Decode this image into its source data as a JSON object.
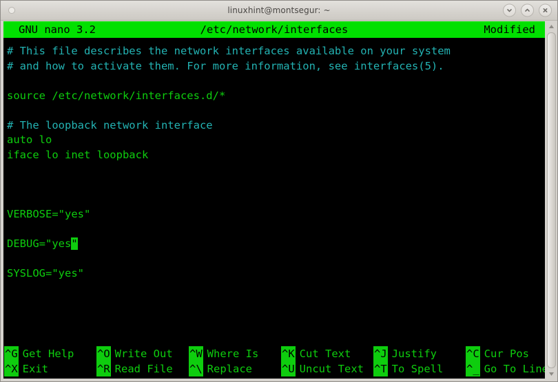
{
  "window": {
    "title": "linuxhint@montsegur: ~",
    "buttons": [
      {
        "name": "minimize",
        "glyph": "chevron-down"
      },
      {
        "name": "maximize",
        "glyph": "chevron-up"
      },
      {
        "name": "close",
        "glyph": "x"
      }
    ]
  },
  "nano": {
    "header": {
      "version": "GNU nano 3.2",
      "filename": "/etc/network/interfaces",
      "status": "Modified"
    },
    "colors": {
      "background": "#000000",
      "header_bg": "#00e000",
      "header_fg": "#000000",
      "code_fg": "#0ecd0e",
      "comment_fg": "#23b3b3",
      "cursor_bg": "#0ecd0e",
      "cursor_fg": "#000000"
    },
    "buffer": [
      {
        "text": "# This file describes the network interfaces available on your system",
        "type": "comment"
      },
      {
        "text": "# and how to activate them. For more information, see interfaces(5).",
        "type": "comment"
      },
      {
        "text": "",
        "type": "blank"
      },
      {
        "text": "source /etc/network/interfaces.d/*",
        "type": "code"
      },
      {
        "text": "",
        "type": "blank"
      },
      {
        "text": "# The loopback network interface",
        "type": "comment"
      },
      {
        "text": "auto lo",
        "type": "code"
      },
      {
        "text": "iface lo inet loopback",
        "type": "code"
      },
      {
        "text": "",
        "type": "blank"
      },
      {
        "text": "",
        "type": "blank"
      },
      {
        "text": "",
        "type": "blank"
      },
      {
        "text": "VERBOSE=\"yes\"",
        "type": "code"
      },
      {
        "text": "",
        "type": "blank"
      },
      {
        "text": "DEBUG=\"yes",
        "cursor_char": "\"",
        "after": "",
        "type": "code-cursor"
      },
      {
        "text": "",
        "type": "blank"
      },
      {
        "text": "SYSLOG=\"yes\"",
        "type": "code"
      }
    ],
    "cursor": {
      "line_index": 13,
      "column": 11,
      "char": "\""
    },
    "help": [
      [
        {
          "key": "^G",
          "label": "Get Help"
        },
        {
          "key": "^O",
          "label": "Write Out"
        },
        {
          "key": "^W",
          "label": "Where Is"
        },
        {
          "key": "^K",
          "label": "Cut Text"
        },
        {
          "key": "^J",
          "label": "Justify"
        },
        {
          "key": "^C",
          "label": "Cur Pos"
        }
      ],
      [
        {
          "key": "^X",
          "label": "Exit"
        },
        {
          "key": "^R",
          "label": "Read File"
        },
        {
          "key": "^\\",
          "label": "Replace"
        },
        {
          "key": "^U",
          "label": "Uncut Text"
        },
        {
          "key": "^T",
          "label": "To Spell"
        },
        {
          "key": "^_",
          "label": "Go To Line"
        }
      ]
    ]
  },
  "scrollbar": {
    "up_arrow": "triangle-up-icon",
    "down_arrow": "triangle-down-icon",
    "thumb": "scroll-thumb"
  }
}
